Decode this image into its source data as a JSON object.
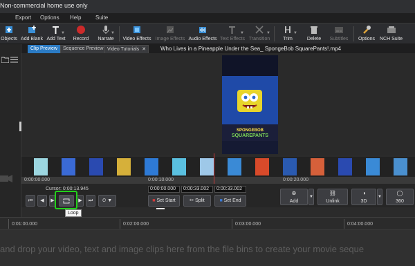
{
  "window": {
    "title": "Non-commercial home use only"
  },
  "menu": [
    "Export",
    "Options",
    "Help",
    "Suite"
  ],
  "toolbar": [
    {
      "label": "Objects",
      "icon": "objects-icon",
      "dim": false
    },
    {
      "label": "Add Blank",
      "icon": "add-blank-icon",
      "dim": false
    },
    {
      "label": "Add Text",
      "icon": "add-text-icon",
      "dim": false
    },
    {
      "label": "Record",
      "icon": "record-icon",
      "dim": false
    },
    {
      "label": "Narrate",
      "icon": "microphone-icon",
      "dim": false
    },
    {
      "label": "Video Effects",
      "icon": "video-effects-icon",
      "dim": false
    },
    {
      "label": "Image Effects",
      "icon": "image-effects-icon",
      "dim": true
    },
    {
      "label": "Audio Effects",
      "icon": "audio-effects-icon",
      "dim": false
    },
    {
      "label": "Text Effects",
      "icon": "text-effects-icon",
      "dim": true
    },
    {
      "label": "Transition",
      "icon": "transition-icon",
      "dim": true
    },
    {
      "label": "Trim",
      "icon": "trim-icon",
      "dim": false
    },
    {
      "label": "Delete",
      "icon": "delete-icon",
      "dim": false
    },
    {
      "label": "Subtitles",
      "icon": "subtitles-icon",
      "dim": true
    },
    {
      "label": "Options",
      "icon": "options-icon",
      "dim": false
    },
    {
      "label": "NCH Suite",
      "icon": "nch-suite-icon",
      "dim": false
    }
  ],
  "tabs": [
    {
      "label": "Clip Preview",
      "active": true,
      "closable": false
    },
    {
      "label": "Sequence Preview",
      "active": false,
      "closable": false
    },
    {
      "label": "Video Tutorials",
      "active": false,
      "closable": true
    }
  ],
  "clip": {
    "title": "Who Lives in a Pineapple Under the Sea_ SpongeBob SquarePants!.mp4",
    "logo_line1": "SPONGEBOB",
    "logo_line2": "SQUAREPANTS"
  },
  "ruler": [
    "0:00:00.000",
    "0:00:10.000",
    "0:00:20.000"
  ],
  "controls": {
    "cursor_label": "Cursor:",
    "cursor_time": "0:00:13.945",
    "set_start_time": "0:00:00.000",
    "duration_time": "0:00:33.002",
    "set_end_time": "0:00:33.002",
    "set_start": "Set Start",
    "split": "Split",
    "set_end": "Set End",
    "add": "Add",
    "unlink": "Unlink",
    "three_d": "3D",
    "three_sixty": "360",
    "loop_tooltip": "Loop"
  },
  "timeline": {
    "marks": [
      "0:01:00.000",
      "0:02:00.000",
      "0:03:00.000",
      "0:04:00.000"
    ],
    "hint": "and drop your video, text and image clips here from the file bins to create your movie seque"
  },
  "colors": {
    "accent": "#2b7bc4",
    "loop_highlight": "#22d11b",
    "playhead": "#d23a3a",
    "logo_green": "#7ed957"
  }
}
